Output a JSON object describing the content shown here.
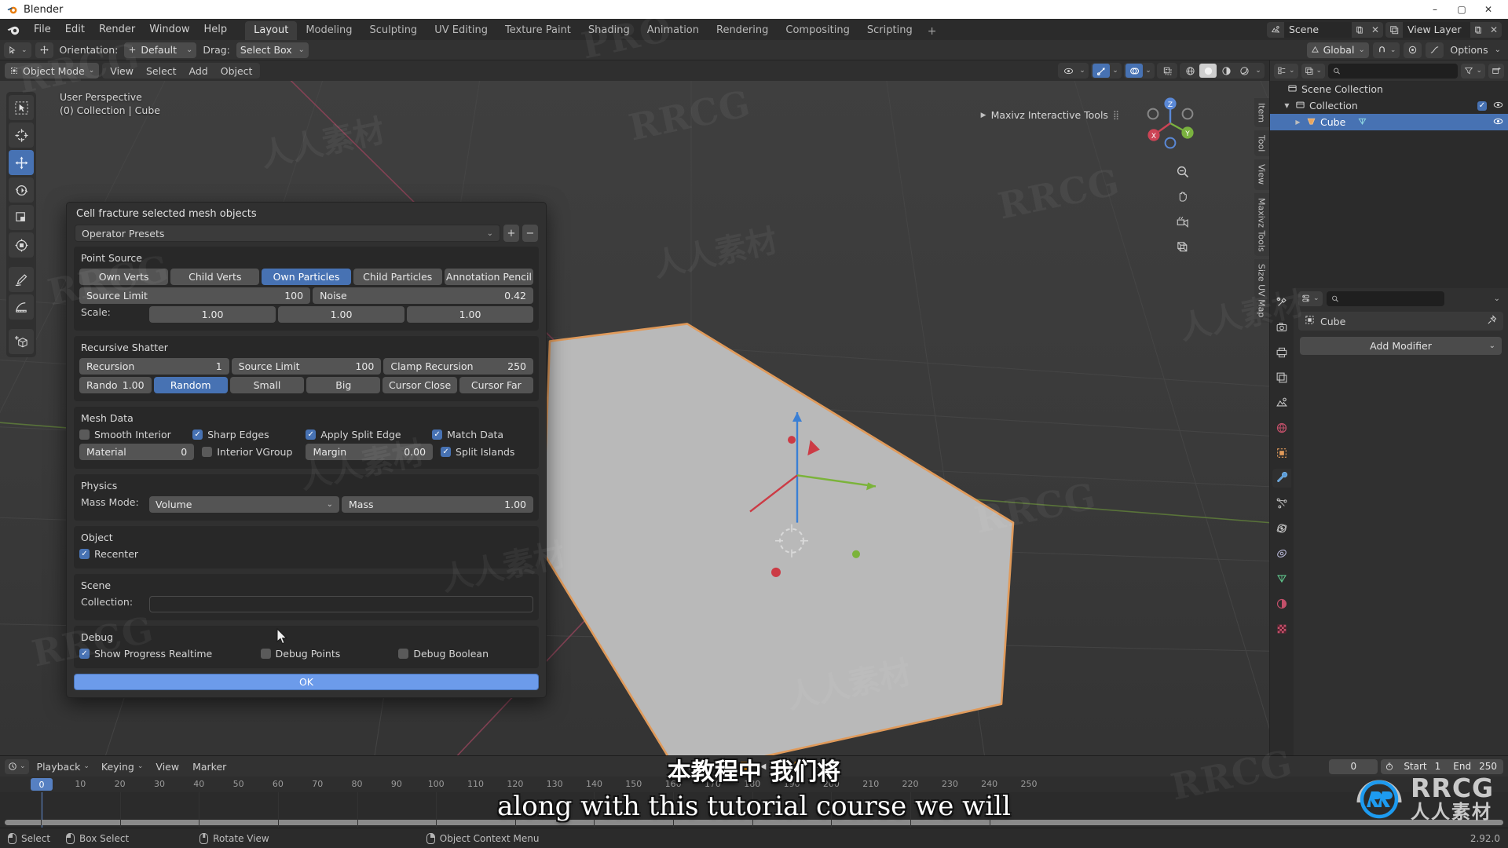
{
  "window": {
    "title": "Blender",
    "app_icon": "blender-logo-icon",
    "minimize": "–",
    "maximize": "▢",
    "close": "✕"
  },
  "topbar": {
    "menus": [
      "File",
      "Edit",
      "Render",
      "Window",
      "Help"
    ],
    "workspaces": [
      "Layout",
      "Modeling",
      "Sculpting",
      "UV Editing",
      "Texture Paint",
      "Shading",
      "Animation",
      "Rendering",
      "Compositing",
      "Scripting"
    ],
    "active_workspace": "Layout",
    "add_workspace": "+",
    "scene_name": "Scene",
    "view_layer_name": "View Layer"
  },
  "tool_header": {
    "orientation_label": "Orientation:",
    "orientation_value": "Default",
    "drag_label": "Drag:",
    "drag_value": "Select Box",
    "transform_global": "Global",
    "options_label": "Options"
  },
  "viewport": {
    "mode": "Object Mode",
    "menus": [
      "View",
      "Select",
      "Add",
      "Object"
    ],
    "overlay_line1": "User Perspective",
    "overlay_line2": "(0) Collection | Cube",
    "maxivz_panel": "Maxivz Interactive Tools",
    "gizmo_axes": [
      "X",
      "Y",
      "Z"
    ],
    "side_tabs": [
      "Item",
      "Tool",
      "View",
      "Maxivz Tools",
      "Size UV Map"
    ],
    "toolbar_icons": [
      "tweak-select-icon",
      "cursor-icon",
      "move-icon",
      "rotate-icon",
      "scale-icon",
      "transform-icon",
      "annotate-icon",
      "measure-icon",
      "add-cube-icon"
    ],
    "active_tool": "move-icon",
    "nav_icons": [
      "zoom-icon",
      "hand-pan-icon",
      "camera-view-icon",
      "ortho-persp-icon"
    ]
  },
  "operator_dialog": {
    "title": "Cell fracture selected mesh objects",
    "preset_label": "Operator Presets",
    "preset_add": "+",
    "preset_remove": "−",
    "sections": {
      "point_source": {
        "title": "Point Source",
        "toggles": [
          "Own Verts",
          "Child Verts",
          "Own Particles",
          "Child Particles",
          "Annotation Pencil"
        ],
        "active_toggle": "Own Particles",
        "source_limit_label": "Source Limit",
        "source_limit_value": "100",
        "noise_label": "Noise",
        "noise_value": "0.42",
        "scale_label": "Scale:",
        "scale_values": [
          "1.00",
          "1.00",
          "1.00"
        ]
      },
      "recursive_shatter": {
        "title": "Recursive Shatter",
        "recursion_label": "Recursion",
        "recursion_value": "1",
        "source_limit_label": "Source Limit",
        "source_limit_value": "100",
        "clamp_recursion_label": "Clamp Recursion",
        "clamp_recursion_value": "250",
        "random_label": "Rando",
        "random_value": "1.00",
        "toggles": [
          "Random",
          "Small",
          "Big",
          "Cursor Close",
          "Cursor Far"
        ],
        "active_toggle": "Random"
      },
      "mesh_data": {
        "title": "Mesh Data",
        "checks_row1": [
          {
            "label": "Smooth Interior",
            "checked": false
          },
          {
            "label": "Sharp Edges",
            "checked": true
          },
          {
            "label": "Apply Split Edge",
            "checked": true
          },
          {
            "label": "Match Data",
            "checked": true
          }
        ],
        "material_label": "Material",
        "material_value": "0",
        "interior_vgroup_label": "Interior VGroup",
        "interior_vgroup_checked": false,
        "margin_label": "Margin",
        "margin_value": "0.00",
        "split_islands_label": "Split Islands",
        "split_islands_checked": true
      },
      "physics": {
        "title": "Physics",
        "mass_mode_label": "Mass Mode:",
        "mass_mode_value": "Volume",
        "mass_label": "Mass",
        "mass_value": "1.00"
      },
      "object": {
        "title": "Object",
        "recenter_label": "Recenter",
        "recenter_checked": true
      },
      "scene": {
        "title": "Scene",
        "collection_label": "Collection:",
        "collection_value": ""
      },
      "debug": {
        "title": "Debug",
        "checks": [
          {
            "label": "Show Progress Realtime",
            "checked": true
          },
          {
            "label": "Debug Points",
            "checked": false
          },
          {
            "label": "Debug Boolean",
            "checked": false
          }
        ]
      }
    },
    "ok_label": "OK"
  },
  "outliner": {
    "search_placeholder": "",
    "display_mode_icon": "outliner-mode-icon",
    "filter_icon": "filter-icon",
    "new_collection_icon": "new-collection-icon",
    "rows": [
      {
        "label": "Scene Collection",
        "icon": "collection-icon",
        "indent": 0,
        "selected": false,
        "expand": "",
        "has_checkbox": false,
        "has_eye": false
      },
      {
        "label": "Collection",
        "icon": "collection-icon",
        "indent": 1,
        "selected": false,
        "expand": "▼",
        "has_checkbox": true,
        "has_eye": true
      },
      {
        "label": "Cube",
        "icon": "mesh-object-icon",
        "indent": 2,
        "selected": true,
        "expand": "▶",
        "has_checkbox": false,
        "has_eye": true
      }
    ]
  },
  "properties": {
    "search_placeholder": "",
    "breadcrumb_object": "Cube",
    "breadcrumb_icon": "object-icon",
    "pin_icon": "pin-icon",
    "add_modifier_label": "Add Modifier",
    "tabs": [
      "tool-icon",
      "render-icon",
      "output-icon",
      "view-layer-icon",
      "scene-icon",
      "world-icon",
      "object-icon",
      "modifier-icon",
      "particles-icon",
      "physics-icon",
      "constraints-icon",
      "object-data-icon",
      "material-icon",
      "texture-icon"
    ],
    "active_tab": "modifier-icon"
  },
  "timeline": {
    "playback_label": "Playback",
    "keying_label": "Keying",
    "view_label": "View",
    "marker_label": "Marker",
    "current_frame": "0",
    "start_label": "Start",
    "start_value": "1",
    "end_label": "End",
    "end_value": "250",
    "ticks": [
      0,
      10,
      20,
      30,
      40,
      50,
      60,
      70,
      80,
      90,
      100,
      110,
      120,
      130,
      140,
      150,
      160,
      170,
      180,
      190,
      200,
      210,
      220,
      230,
      240,
      250
    ],
    "playhead_frame": "0"
  },
  "statusbar": {
    "items": [
      {
        "icon": "mouse-left-icon",
        "label": "Select"
      },
      {
        "icon": "mouse-left-drag-icon",
        "label": "Box Select"
      },
      {
        "icon": "mouse-middle-icon",
        "label": "Rotate View"
      },
      {
        "icon": "mouse-right-icon",
        "label": "Object Context Menu"
      }
    ],
    "version": "2.92.0"
  },
  "subtitles": {
    "chinese": "本教程中 我们将",
    "english": "along with this tutorial course we will"
  },
  "branding": {
    "logo_text_1": "RRCG",
    "logo_text_2": "人人素材",
    "watermarks": [
      "RRCG",
      "人人素材",
      "PRO"
    ]
  },
  "colors": {
    "accent_blue": "#4772b3",
    "ok_button": "#6c9bea",
    "selection_orange": "#e09a5a",
    "panel_bg": "#303030",
    "sub_panel_bg": "#282828"
  }
}
